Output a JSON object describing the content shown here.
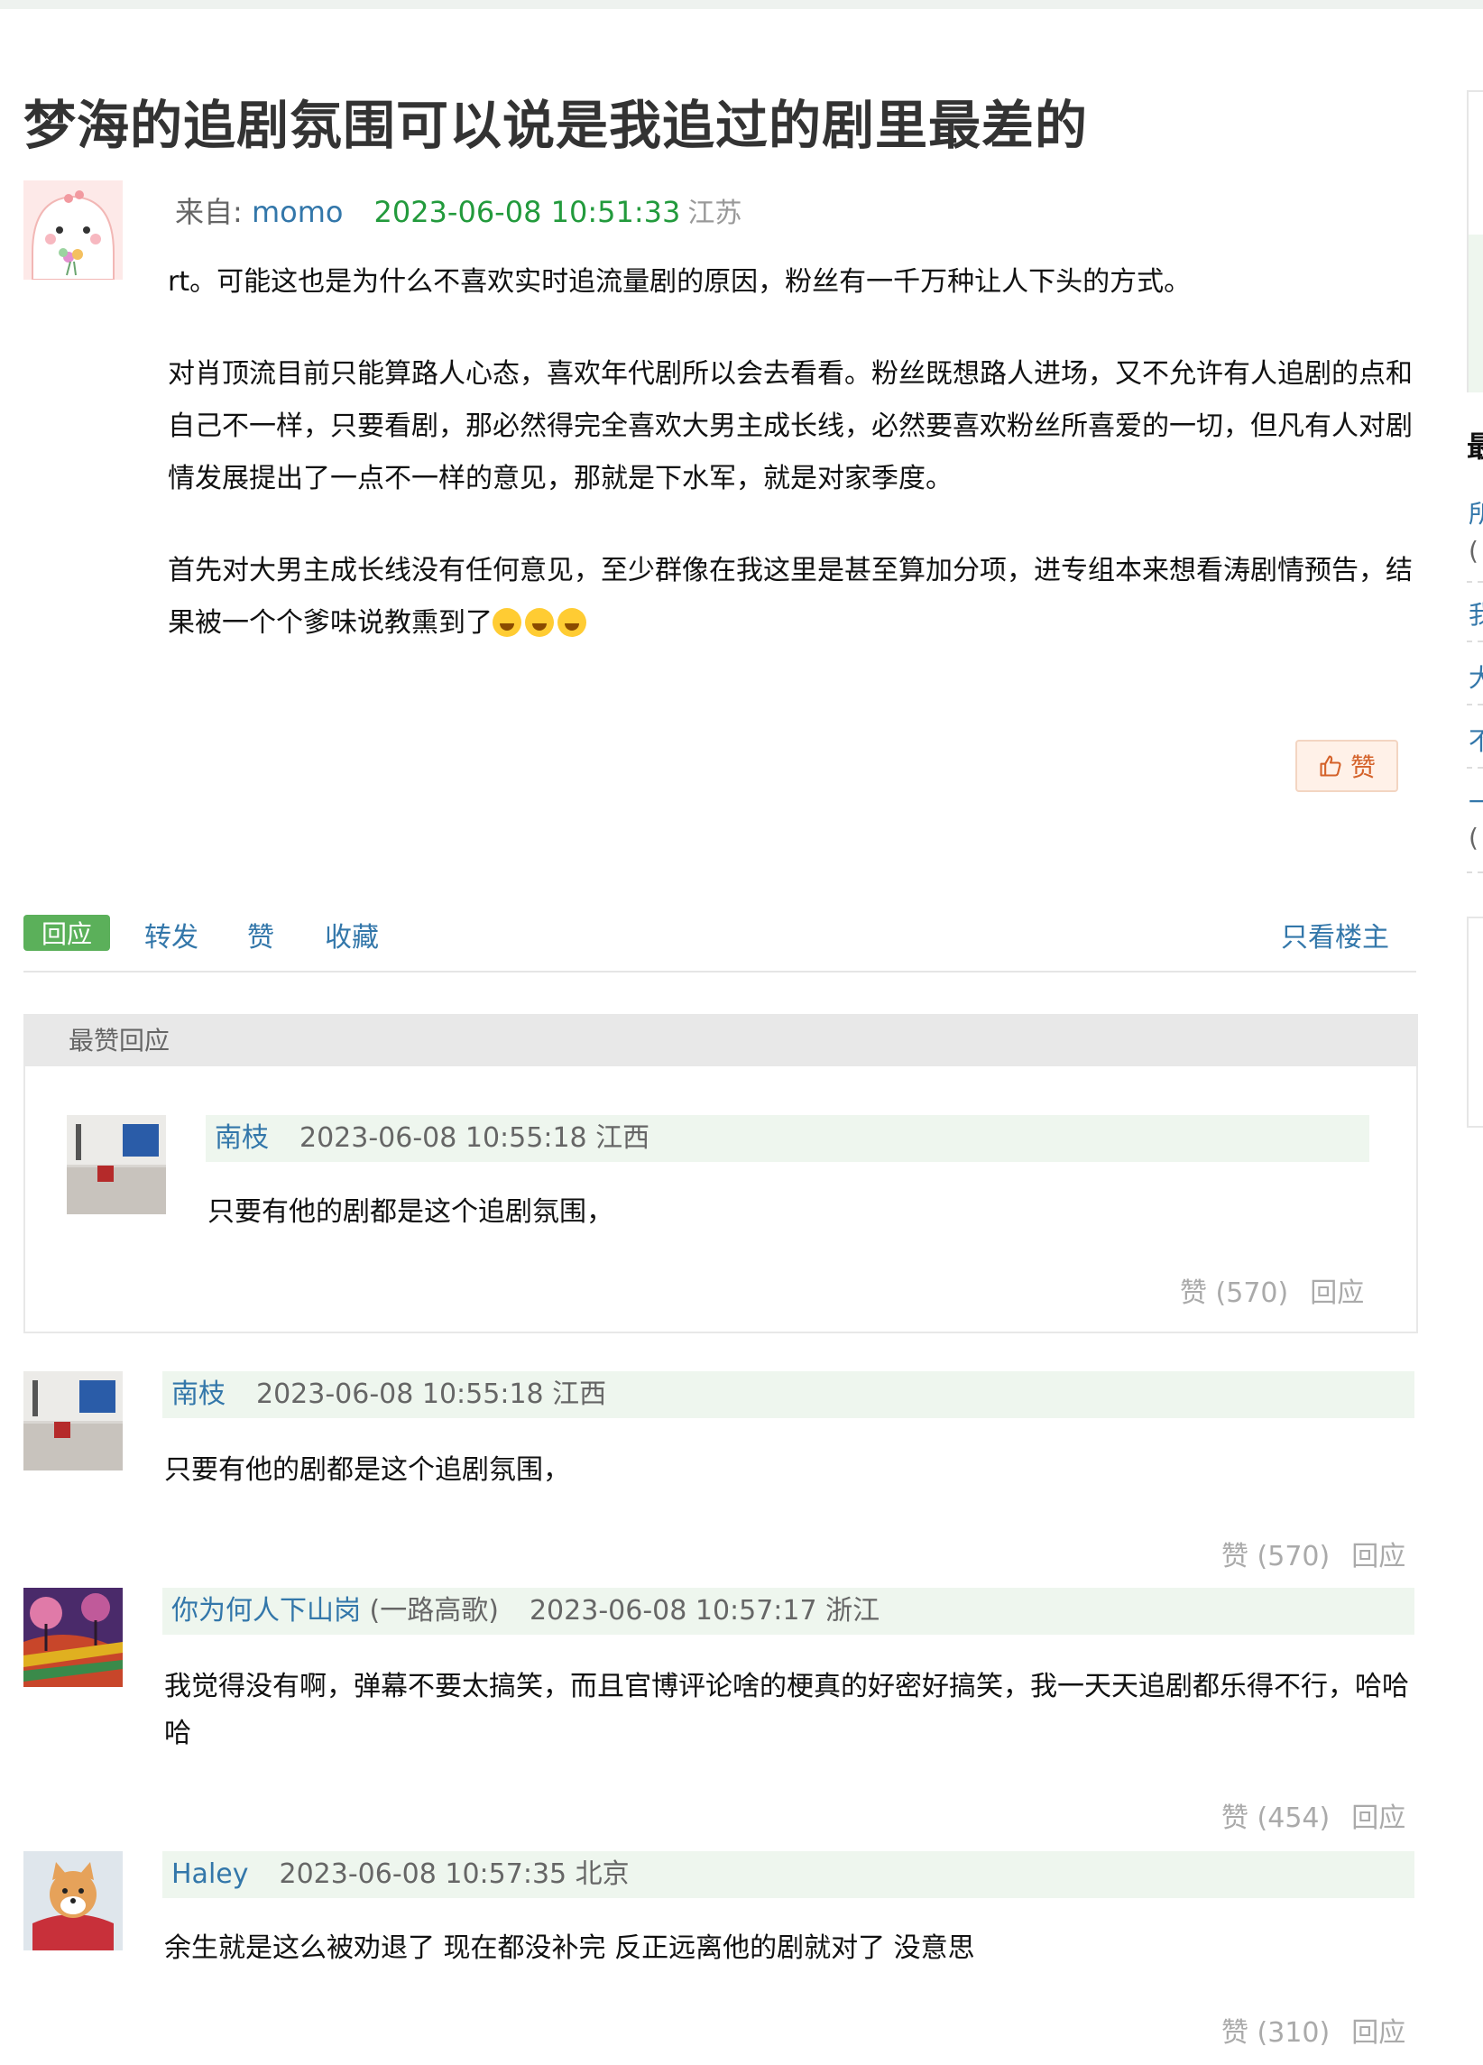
{
  "post": {
    "title": "梦海的追剧氛围可以说是我追过的剧里最差的",
    "from_label": "来自: ",
    "author": "momo",
    "time": "2023-06-08 10:51:33",
    "location": "江苏",
    "paragraphs": [
      "rt。可能这也是为什么不喜欢实时追流量剧的原因，粉丝有一千万种让人下头的方式。",
      "对肖顶流目前只能算路人心态，喜欢年代剧所以会去看看。粉丝既想路人进场，又不允许有人追剧的点和自己不一样，只要看剧，那必然得完全喜欢大男主成长线，必然要喜欢粉丝所喜爱的一切，但凡有人对剧情发展提出了一点不一样的意见，那就是下水军，就是对家季度。",
      "首先对大男主成长线没有任何意见，至少群像在我这里是甚至算加分项，进专组本来想看涛剧情预告，结果被一个个爹味说教熏到了"
    ],
    "like_button": "赞"
  },
  "actions": {
    "reply": "回应",
    "forward": "转发",
    "like": "赞",
    "collect": "收藏",
    "only_author": "只看楼主"
  },
  "best": {
    "header": "最赞回应",
    "comment": {
      "user": "南枝",
      "time": "2023-06-08 10:55:18",
      "location": "江西",
      "text": "只要有他的剧都是这个追剧氛围，",
      "likes": "赞 (570)",
      "reply": "回应"
    }
  },
  "comments": [
    {
      "user": "南枝",
      "nickname": "",
      "time": "2023-06-08 10:55:18",
      "location": "江西",
      "text": "只要有他的剧都是这个追剧氛围，",
      "likes": "赞 (570)",
      "reply": "回应"
    },
    {
      "user": "你为何人下山岗",
      "nickname": "(一路高歌)",
      "time": "2023-06-08 10:57:17",
      "location": "浙江",
      "text": "我觉得没有啊，弹幕不要太搞笑，而且官博评论啥的梗真的好密好搞笑，我一天天追剧都乐得不行，哈哈哈",
      "likes": "赞 (454)",
      "reply": "回应"
    },
    {
      "user": "Haley",
      "nickname": "",
      "time": "2023-06-08 10:57:35",
      "location": "北京",
      "text": "余生就是这么被劝退了 现在都没补完 反正远离他的剧就对了 没意思",
      "likes": "赞 (310)",
      "reply": "回应"
    }
  ],
  "sidebar": {
    "heading_fragment": "最",
    "link_fragments": [
      "所",
      "(",
      "我",
      "大",
      "不",
      "一",
      "("
    ]
  }
}
